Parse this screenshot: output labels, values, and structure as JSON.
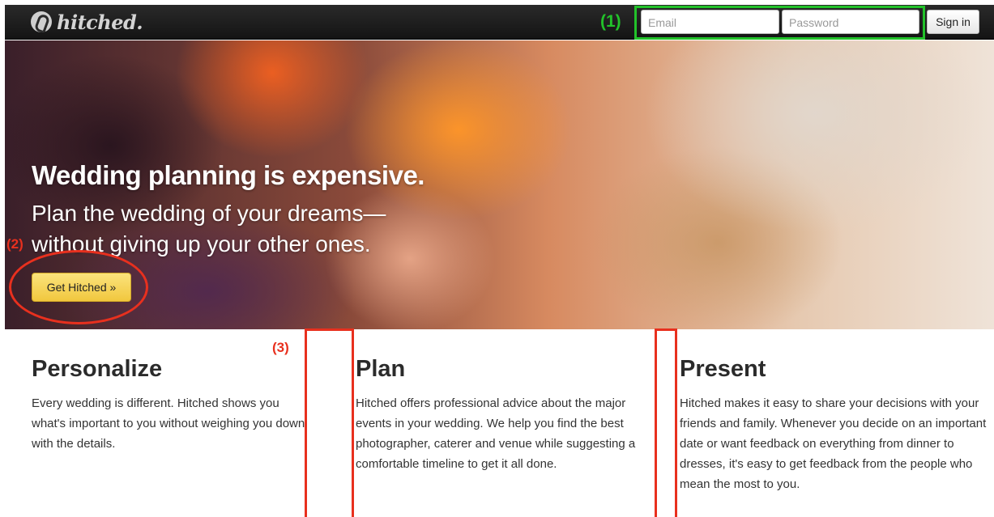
{
  "navbar": {
    "brand": "hitched.",
    "email_placeholder": "Email",
    "password_placeholder": "Password",
    "signin_label": "Sign in"
  },
  "annotations": {
    "one": "(1)",
    "two": "(2)",
    "three": "(3)"
  },
  "hero": {
    "headline": "Wedding planning is expensive.",
    "subline": "Plan the wedding of your dreams—without giving up your other ones.",
    "cta_label": "Get Hitched »"
  },
  "features": [
    {
      "title": "Personalize",
      "body": "Every wedding is different. Hitched shows you what's important to you without weighing you down with the details."
    },
    {
      "title": "Plan",
      "body": "Hitched offers professional advice about the major events in your wedding. We help you find the best photographer, caterer and venue while suggesting a comfortable timeline to get it all done."
    },
    {
      "title": "Present",
      "body": "Hitched makes it easy to share your decisions with your friends and family. Whenever you decide on an important date or want feedback on everything from dinner to dresses, it's easy to get feedback from the people who mean the most to you."
    }
  ],
  "colors": {
    "annotation_green": "#22c22a",
    "annotation_red": "#e8301e",
    "cta_yellow": "#f6d65a",
    "navbar": "#1c1c1c"
  },
  "icons": {
    "brand_logo": "hitched-logo-icon"
  }
}
